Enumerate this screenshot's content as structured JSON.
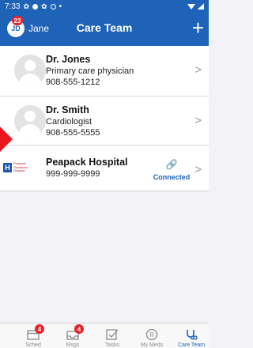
{
  "status_bar": {
    "time": "7:33"
  },
  "header": {
    "avatar_initials": "JD",
    "avatar_badge": "23",
    "user_name": "Jane",
    "title": "Care Team",
    "add_glyph": "+"
  },
  "care_team": [
    {
      "name": "Dr. Jones",
      "role": "Primary care physician",
      "phone": "908-555-1212"
    },
    {
      "name": "Dr. Smith",
      "role": "Cardiologist",
      "phone": "908-555-5555"
    }
  ],
  "hospital": {
    "name": "Peapack Hospital",
    "phone": "999-999-9999",
    "status": "Connected",
    "logo_letter": "H",
    "logo_text_lines": [
      "Peapack",
      "Gladstone",
      "Hospital"
    ]
  },
  "colors": {
    "primary": "#1e63b8",
    "badge": "#e8212a",
    "marker": "#e8181f"
  },
  "tab_bar": {
    "tabs": [
      {
        "icon": "calendar-icon",
        "label": "Sched",
        "badge": "4"
      },
      {
        "icon": "inbox-icon",
        "label": "Msgs",
        "badge": "4"
      },
      {
        "icon": "checkbox-icon",
        "label": "Tasks",
        "badge": ""
      },
      {
        "icon": "prescription-icon",
        "label": "My Meds",
        "badge": ""
      },
      {
        "icon": "stethoscope-icon",
        "label": "Care Team",
        "badge": ""
      }
    ]
  }
}
